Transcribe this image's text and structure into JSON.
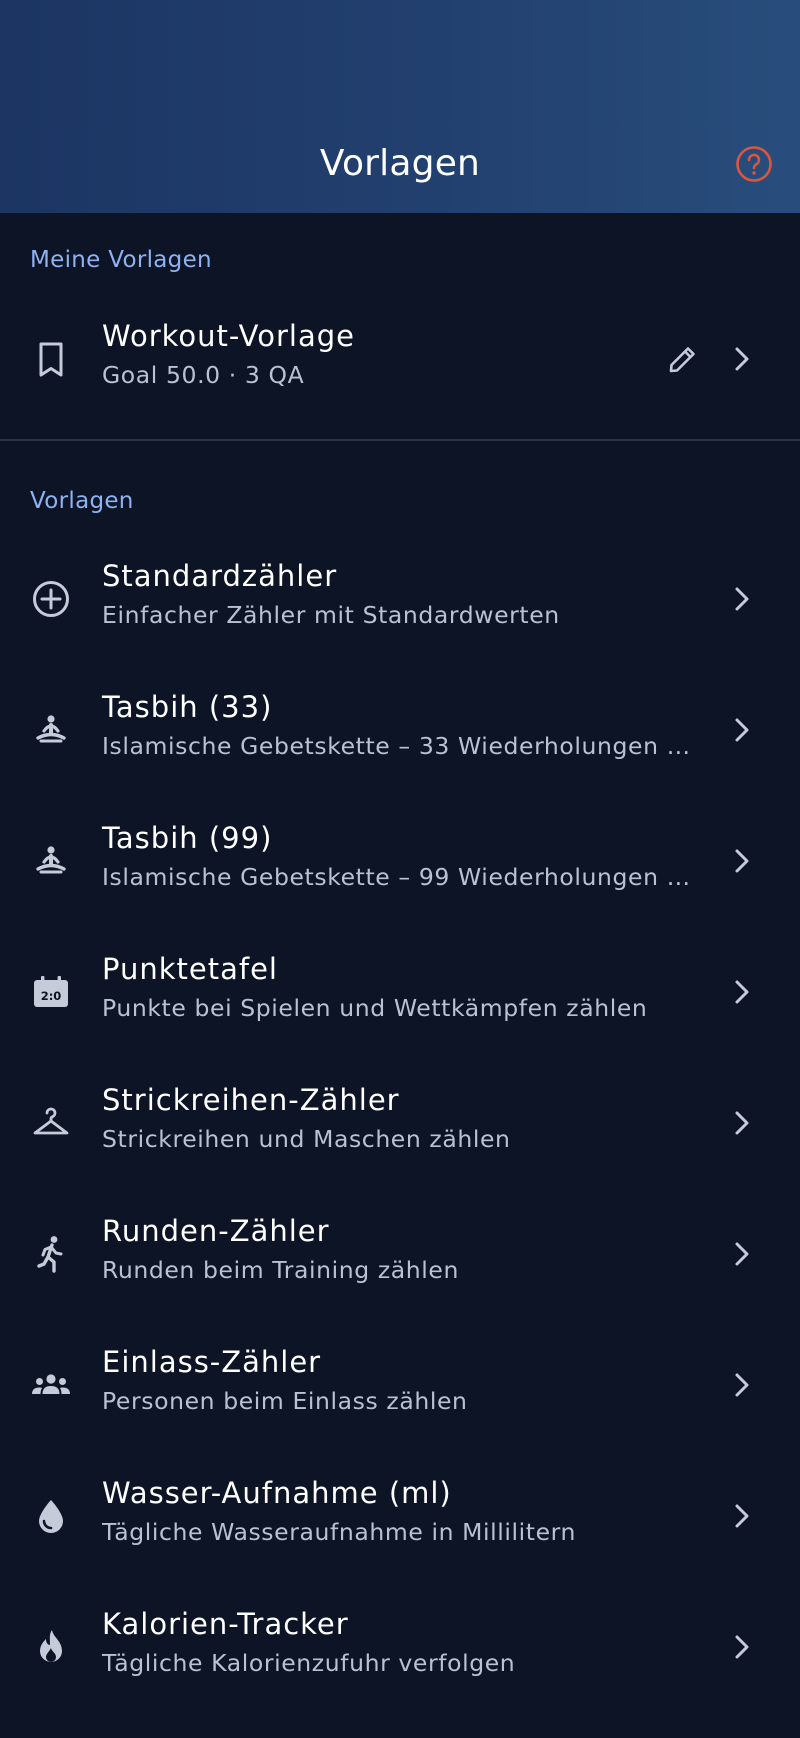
{
  "header": {
    "title": "Vorlagen",
    "help_icon": "help-circle-icon",
    "help_color": "#d9573f"
  },
  "my_templates": {
    "label": "Meine Vorlagen",
    "items": [
      {
        "icon": "bookmark-icon",
        "title": "Workout-Vorlage",
        "subtitle": "Goal 50.0 · 3 QA"
      }
    ]
  },
  "templates": {
    "label": "Vorlagen",
    "items": [
      {
        "icon": "add-circle-icon",
        "title": "Standardzähler",
        "subtitle": "Einfacher Zähler mit Standardwerten"
      },
      {
        "icon": "meditation-icon",
        "title": "Tasbih (33)",
        "subtitle": "Islamische Gebetskette – 33 Wiederholungen …"
      },
      {
        "icon": "meditation-icon",
        "title": "Tasbih (99)",
        "subtitle": "Islamische Gebetskette – 99 Wiederholungen …"
      },
      {
        "icon": "scoreboard-icon",
        "title": "Punktetafel",
        "subtitle": "Punkte bei Spielen und Wettkämpfen zählen"
      },
      {
        "icon": "hanger-icon",
        "title": "Strickreihen-Zähler",
        "subtitle": "Strickreihen und Maschen zählen"
      },
      {
        "icon": "running-icon",
        "title": "Runden-Zähler",
        "subtitle": "Runden beim Training zählen"
      },
      {
        "icon": "group-icon",
        "title": "Einlass-Zähler",
        "subtitle": "Personen beim Einlass zählen"
      },
      {
        "icon": "water-drop-icon",
        "title": "Wasser-Aufnahme (ml)",
        "subtitle": "Tägliche Wasseraufnahme in Millilitern"
      },
      {
        "icon": "flame-icon",
        "title": "Kalorien-Tracker",
        "subtitle": "Tägliche Kalorienzufuhr verfolgen"
      }
    ]
  },
  "colors": {
    "background": "#0d1426",
    "section_label": "#8fb2f0",
    "icon": "#c5cbd8",
    "subtitle": "#b9c2d3"
  }
}
